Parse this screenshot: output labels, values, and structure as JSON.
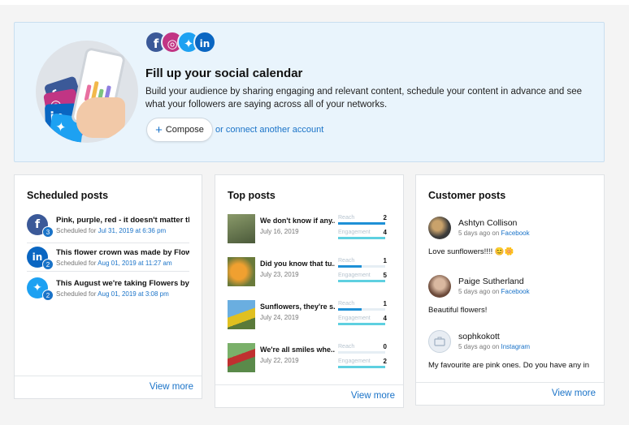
{
  "hero": {
    "title": "Fill up your social calendar",
    "description": "Build your audience by sharing engaging and relevant content, schedule your content in advance and see what your followers are saying across all of your networks.",
    "compose_label": "Compose",
    "connect_label": "or connect another account",
    "social_icons": [
      "facebook-icon",
      "instagram-icon",
      "twitter-icon",
      "linkedin-icon"
    ]
  },
  "scheduled": {
    "title": "Scheduled posts",
    "view_more": "View more",
    "items": [
      {
        "network": "facebook",
        "count": "3",
        "text": "Pink, purple, red - it doesn't matter the c",
        "prefix": "Scheduled for ",
        "when": "Jul 31, 2019 at 6:36 pm"
      },
      {
        "network": "linkedin",
        "count": "2",
        "text": "This flower crown was made by Flowers",
        "prefix": "Scheduled for ",
        "when": "Aug 01, 2019 at 11:27 am"
      },
      {
        "network": "twitter",
        "count": "2",
        "text": "This August we're taking Flowers by Jan",
        "prefix": "Scheduled for ",
        "when": "Aug 01, 2019 at 3:08 pm"
      }
    ]
  },
  "top_posts": {
    "title": "Top posts",
    "view_more": "View more",
    "reach_label": "Reach",
    "engagement_label": "Engagement",
    "items": [
      {
        "text": "We don't know if any...",
        "date": "July 16, 2019",
        "reach": "2",
        "engagement": "4",
        "reach_fill": 1.0,
        "engagement_fill": 1.0
      },
      {
        "text": "Did you know that tu...",
        "date": "July 23, 2019",
        "reach": "1",
        "engagement": "5",
        "reach_fill": 0.5,
        "engagement_fill": 1.0
      },
      {
        "text": "Sunflowers, they're s...",
        "date": "July 24, 2019",
        "reach": "1",
        "engagement": "4",
        "reach_fill": 0.5,
        "engagement_fill": 1.0
      },
      {
        "text": "We're all smiles whe...",
        "date": "July 22, 2019",
        "reach": "0",
        "engagement": "2",
        "reach_fill": 0.0,
        "engagement_fill": 1.0
      }
    ]
  },
  "customer_posts": {
    "title": "Customer posts",
    "view_more": "View more",
    "items": [
      {
        "name": "Ashtyn Collison",
        "ago": "5 days ago on ",
        "network": "Facebook",
        "message": "Love sunflowers!!!! 😊🌼"
      },
      {
        "name": "Paige Sutherland",
        "ago": "5 days ago on ",
        "network": "Facebook",
        "message": "Beautiful flowers!"
      },
      {
        "name": "sophkokott",
        "ago": "5 days ago on ",
        "network": "Instagram",
        "message": "My favourite are pink ones. Do you have any in sto"
      }
    ]
  },
  "colors": {
    "accent": "#1a73c8",
    "facebook": "#3b5998",
    "instagram": "#c13584",
    "twitter": "#1da1f2",
    "linkedin": "#0a66c2",
    "reach_bar": "#1e90d6",
    "engagement_bar": "#5ed0e0"
  }
}
